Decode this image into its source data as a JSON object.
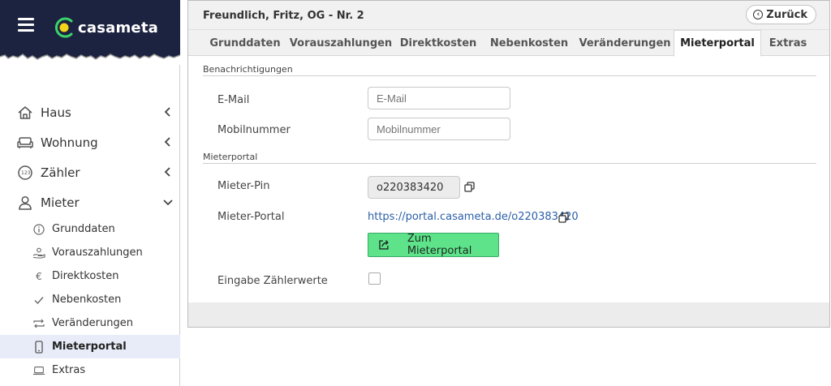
{
  "brand": {
    "name": "casameta",
    "accent": "#f2d418",
    "ring": "#3bd46b",
    "bar_bg": "#1c2340"
  },
  "sidebar": {
    "items": [
      {
        "label": "Haus",
        "icon": "house-icon"
      },
      {
        "label": "Wohnung",
        "icon": "sofa-icon"
      },
      {
        "label": "Zähler",
        "icon": "meter-icon"
      },
      {
        "label": "Mieter",
        "icon": "person-icon"
      }
    ],
    "sub_items": [
      {
        "label": "Grunddaten",
        "icon": "info-icon"
      },
      {
        "label": "Vorauszahlungen",
        "icon": "hand-coin-icon"
      },
      {
        "label": "Direktkosten",
        "icon": "euro-icon"
      },
      {
        "label": "Nebenkosten",
        "icon": "check-icon"
      },
      {
        "label": "Veränderungen",
        "icon": "swap-icon"
      },
      {
        "label": "Mieterportal",
        "icon": "phone-icon"
      },
      {
        "label": "Extras",
        "icon": "laptop-icon"
      }
    ]
  },
  "header": {
    "title": "Freundlich, Fritz, OG - Nr. 2",
    "back_label": "Zurück"
  },
  "tabs": [
    {
      "label": "Grunddaten"
    },
    {
      "label": "Vorauszahlungen"
    },
    {
      "label": "Direktkosten"
    },
    {
      "label": "Nebenkosten"
    },
    {
      "label": "Veränderungen"
    },
    {
      "label": "Mieterportal"
    },
    {
      "label": "Extras"
    }
  ],
  "notifications": {
    "section_label": "Benachrichtigungen",
    "email_label": "E-Mail",
    "email_placeholder": "E-Mail",
    "mobile_label": "Mobilnummer",
    "mobile_placeholder": "Mobilnummer"
  },
  "portal": {
    "section_label": "Mieterportal",
    "pin_label": "Mieter-Pin",
    "pin_value": "o220383420",
    "url_label": "Mieter-Portal",
    "url_value": "https://portal.casameta.de/o220383420",
    "button_label": "Zum Mieterportal",
    "meter_input_label": "Eingabe Zählerwerte"
  }
}
